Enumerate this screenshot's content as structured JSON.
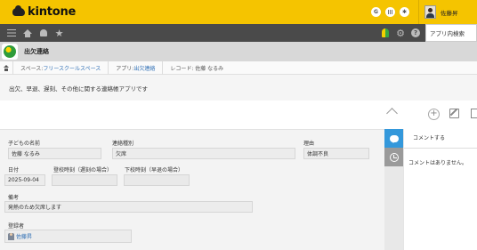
{
  "header": {
    "logo_text": "kintone",
    "icons": [
      "google-icon",
      "grid-icon",
      "settings-icon"
    ],
    "user_name": "佐藤昇"
  },
  "navbar": {
    "search_label": "アプリ内検索"
  },
  "app": {
    "name": "出欠連絡"
  },
  "breadcrumb": {
    "space_prefix": "スペース: ",
    "space_name": "フリースクールスペース",
    "app_prefix": "アプリ: ",
    "app_name": "出欠連絡",
    "record_label": "レコード: 佐藤 なるみ"
  },
  "description": "出欠、早退、遅刻、その他に関する連絡帳アプリです",
  "record": {
    "fields": {
      "child_name": {
        "label": "子どもの名前",
        "value": "佐藤 なるみ"
      },
      "contact_type": {
        "label": "連絡種別",
        "value": "欠席"
      },
      "reason": {
        "label": "理由",
        "value": "体調不良"
      },
      "date": {
        "label": "日付",
        "value": "2025-09-04"
      },
      "arrival_time": {
        "label": "登校時刻（遅刻の場合）",
        "value": ""
      },
      "leave_time": {
        "label": "下校時刻（早退の場合）",
        "value": ""
      },
      "notes": {
        "label": "備考",
        "value": "発熱のため欠席します"
      },
      "registrant": {
        "label": "登録者",
        "value": "佐藤昇"
      }
    }
  },
  "comments": {
    "post_label": "コメントする",
    "empty_text": "コメントはありません。"
  },
  "colors": {
    "topbar": "#f5c400",
    "navbar": "#4a4a4a",
    "accent": "#3498db",
    "link": "#2f6fb5"
  }
}
